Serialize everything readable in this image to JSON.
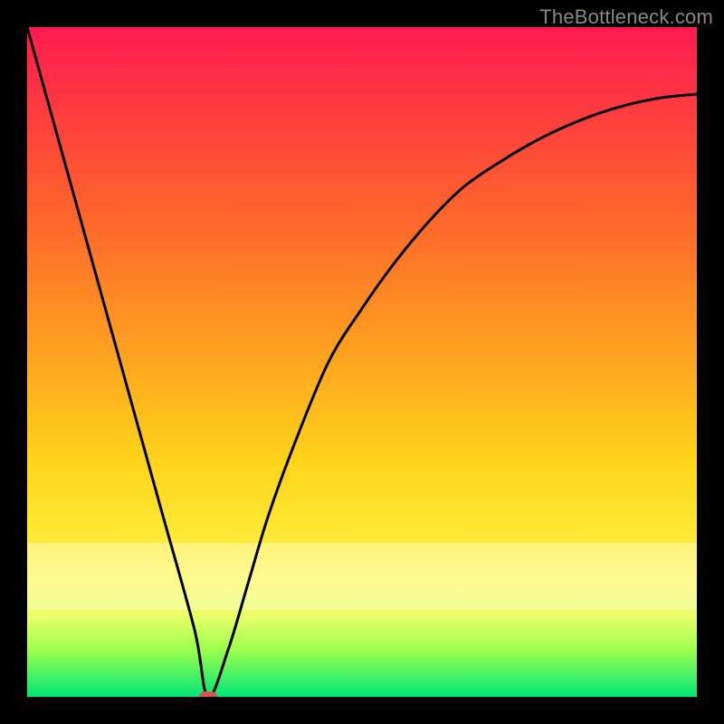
{
  "watermark": "TheBottleneck.com",
  "colors": {
    "frame": "#000000",
    "marker": "#d9534f",
    "curve": "#000000"
  },
  "chart_data": {
    "type": "line",
    "title": "",
    "xlabel": "",
    "ylabel": "",
    "xlim": [
      0,
      100
    ],
    "ylim": [
      0,
      100
    ],
    "grid": false,
    "legend": false,
    "series": [
      {
        "name": "bottleneck-curve",
        "x": [
          0,
          5,
          10,
          15,
          20,
          25,
          27,
          30,
          33,
          36,
          40,
          45,
          50,
          55,
          60,
          65,
          70,
          75,
          80,
          85,
          90,
          95,
          100
        ],
        "values": [
          100,
          82,
          64,
          46,
          28,
          10,
          0,
          7,
          17,
          27,
          38,
          50,
          58,
          65,
          71,
          76,
          79.5,
          82.5,
          85,
          87,
          88.5,
          89.5,
          90
        ]
      }
    ],
    "marker": {
      "x": 27,
      "y": 0
    },
    "bands": [
      {
        "ymin": 77,
        "ymax": 87,
        "label": "pale-yellow-band"
      }
    ],
    "gradient_stops": [
      {
        "pos": 0,
        "color": "#ff1a52"
      },
      {
        "pos": 12,
        "color": "#ff3a3f"
      },
      {
        "pos": 30,
        "color": "#ff6a2a"
      },
      {
        "pos": 50,
        "color": "#ffa61f"
      },
      {
        "pos": 65,
        "color": "#ffd41a"
      },
      {
        "pos": 75,
        "color": "#ffe733"
      },
      {
        "pos": 82,
        "color": "#fff75a"
      },
      {
        "pos": 88,
        "color": "#e8ff6a"
      },
      {
        "pos": 93,
        "color": "#9cff4d"
      },
      {
        "pos": 100,
        "color": "#00e676"
      }
    ]
  }
}
